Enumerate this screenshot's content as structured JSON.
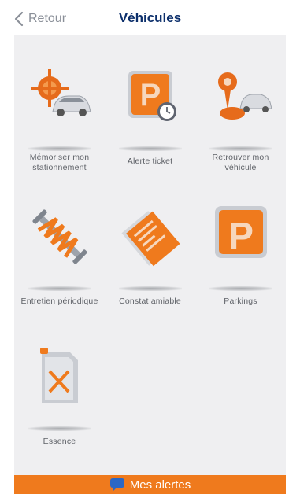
{
  "nav": {
    "back_label": "Retour",
    "title": "Véhicules"
  },
  "tiles": [
    {
      "line1": "Mémoriser mon",
      "line2": "stationnement",
      "icon": "parked-car-locator-icon"
    },
    {
      "line1": "Alerte ticket",
      "line2": "",
      "icon": "parking-ticket-clock-icon"
    },
    {
      "line1": "Retrouver mon",
      "line2": "véhicule",
      "icon": "find-car-pin-icon"
    },
    {
      "line1": "Entretien périodique",
      "line2": "",
      "icon": "shock-absorber-icon"
    },
    {
      "line1": "Constat amiable",
      "line2": "",
      "icon": "accident-report-icon"
    },
    {
      "line1": "Parkings",
      "line2": "",
      "icon": "parking-sign-icon"
    },
    {
      "line1": "Essence",
      "line2": "",
      "icon": "fuel-can-icon"
    }
  ],
  "bottom_bar": {
    "label": "Mes alertes",
    "icon": "chat-bubble-icon"
  },
  "colors": {
    "accent": "#ef7a1d",
    "title": "#0c2f6b",
    "background": "#efeff1"
  }
}
